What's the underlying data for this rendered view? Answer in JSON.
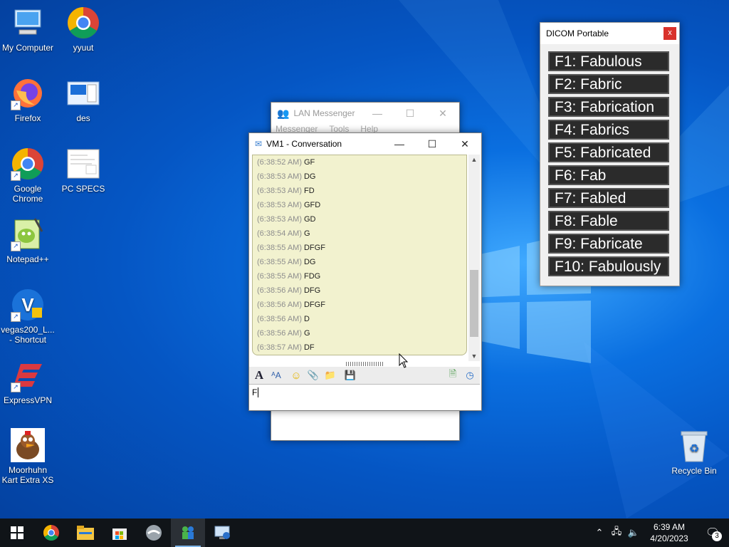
{
  "desktop": {
    "icons": [
      {
        "label": "My Computer",
        "icon": "computer-icon"
      },
      {
        "label": "yyuut",
        "icon": "chrome-icon"
      },
      {
        "label": "Firefox",
        "icon": "firefox-icon"
      },
      {
        "label": "des",
        "icon": "document-icon"
      },
      {
        "label": "Google Chrome",
        "icon": "chrome-icon"
      },
      {
        "label": "PC SPECS",
        "icon": "document-icon"
      },
      {
        "label": "Notepad++",
        "icon": "notepadpp-icon"
      },
      {
        "label": "vegas200_L... - Shortcut",
        "icon": "vegas-icon"
      },
      {
        "label": "ExpressVPN",
        "icon": "expressvpn-icon"
      },
      {
        "label": "Moorhuhn Kart Extra XS",
        "icon": "moorhuhn-icon"
      },
      {
        "label": "Recycle Bin",
        "icon": "recycle-bin-icon"
      }
    ]
  },
  "lan_window": {
    "title": "LAN Messenger",
    "menu": [
      "Messenger",
      "Tools",
      "Help"
    ]
  },
  "conversation": {
    "title": "VM1 - Conversation",
    "messages": [
      {
        "time": "(6:38:52 AM)",
        "text": "GF"
      },
      {
        "time": "(6:38:53 AM)",
        "text": "DG"
      },
      {
        "time": "(6:38:53 AM)",
        "text": "FD"
      },
      {
        "time": "(6:38:53 AM)",
        "text": "GFD"
      },
      {
        "time": "(6:38:53 AM)",
        "text": "GD"
      },
      {
        "time": "(6:38:54 AM)",
        "text": "G"
      },
      {
        "time": "(6:38:55 AM)",
        "text": "DFGF"
      },
      {
        "time": "(6:38:55 AM)",
        "text": "DG"
      },
      {
        "time": "(6:38:55 AM)",
        "text": "FDG"
      },
      {
        "time": "(6:38:56 AM)",
        "text": "DFG"
      },
      {
        "time": "(6:38:56 AM)",
        "text": "DFGF"
      },
      {
        "time": "(6:38:56 AM)",
        "text": "D"
      },
      {
        "time": "(6:38:56 AM)",
        "text": "G"
      },
      {
        "time": "(6:38:57 AM)",
        "text": "DF"
      }
    ],
    "input_value": "F",
    "toolbar_icons": [
      "font-icon",
      "font-color-icon",
      "smiley-icon",
      "attach-file-icon",
      "send-folder-icon",
      "save-icon",
      "history-icon",
      "clock-icon"
    ]
  },
  "dicom": {
    "title": "DICOM Portable",
    "close_label": "x",
    "buttons": [
      "F1: Fabulous",
      "F2: Fabric",
      "F3: Fabrication",
      "F4: Fabrics",
      "F5: Fabricated",
      "F6: Fab",
      "F7: Fabled",
      "F8: Fable",
      "F9: Fabricate",
      "F10: Fabulously"
    ]
  },
  "taskbar": {
    "apps": [
      "start-icon",
      "chrome-icon",
      "file-explorer-icon",
      "store-icon",
      "app-icon",
      "lan-messenger-icon",
      "remote-icon"
    ],
    "clock_time": "6:39 AM",
    "clock_date": "4/20/2023",
    "notification_count": "3"
  },
  "colors": {
    "desktop_blue": "#0a6fe0",
    "chat_bg": "#f2f2cf",
    "dicom_button_bg": "#2b2b2b"
  }
}
